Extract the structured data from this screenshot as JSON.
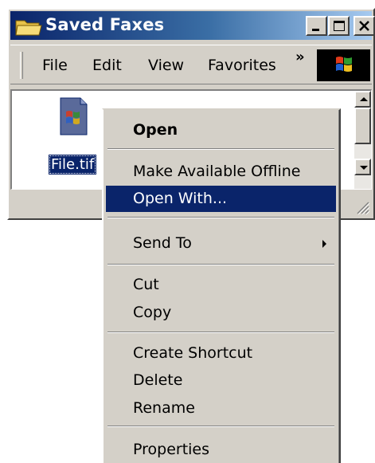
{
  "window": {
    "title": "Saved Faxes",
    "menus": [
      "File",
      "Edit",
      "View",
      "Favorites"
    ],
    "chevron": "»"
  },
  "file": {
    "name": "File.tif"
  },
  "context_menu": {
    "open": "Open",
    "make_available_offline": "Make Available Offline",
    "open_with": "Open With...",
    "send_to": "Send To",
    "cut": "Cut",
    "copy": "Copy",
    "create_shortcut": "Create Shortcut",
    "delete": "Delete",
    "rename": "Rename",
    "properties": "Properties",
    "highlighted": "Open With...",
    "highlight_color": "#0a246a"
  },
  "icons": {
    "title": "folder-icon",
    "file": "tif-file-icon",
    "logo": "windows-logo-icon"
  }
}
